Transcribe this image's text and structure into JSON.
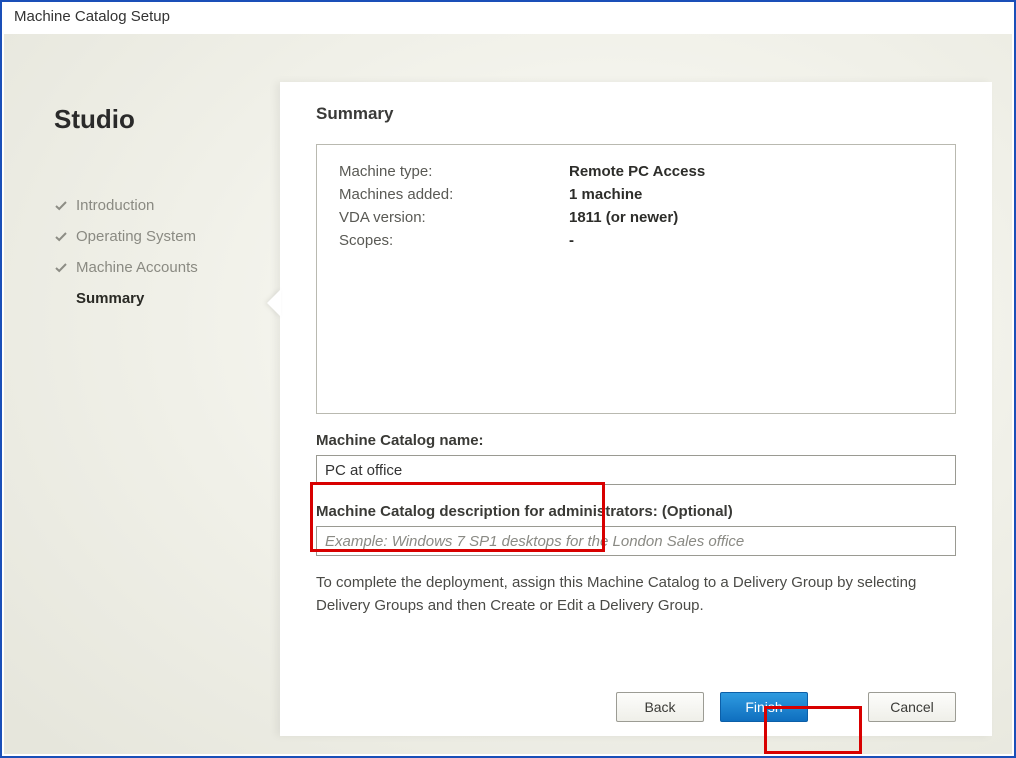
{
  "window": {
    "title": "Machine Catalog Setup"
  },
  "sidebar": {
    "brand": "Studio",
    "steps": [
      {
        "label": "Introduction",
        "done": true
      },
      {
        "label": "Operating System",
        "done": true
      },
      {
        "label": "Machine Accounts",
        "done": true
      },
      {
        "label": "Summary",
        "done": false,
        "current": true
      }
    ]
  },
  "panel": {
    "heading": "Summary",
    "summary": [
      {
        "k": "Machine type:",
        "v": "Remote PC Access"
      },
      {
        "k": "Machines added:",
        "v": "1 machine"
      },
      {
        "k": "VDA version:",
        "v": "1811 (or newer)"
      },
      {
        "k": "Scopes:",
        "v": "-"
      }
    ],
    "name_label": "Machine Catalog name:",
    "name_value": "PC at office",
    "desc_label": "Machine Catalog description for administrators: (Optional)",
    "desc_placeholder": "Example: Windows 7 SP1 desktops for the London Sales office",
    "desc_value": "",
    "help": "To complete the deployment, assign this Machine Catalog to a Delivery Group by selecting Delivery Groups and then Create or Edit a Delivery Group."
  },
  "buttons": {
    "back": "Back",
    "finish": "Finish",
    "cancel": "Cancel"
  },
  "highlights": {
    "name_field": true,
    "finish_button": true
  }
}
